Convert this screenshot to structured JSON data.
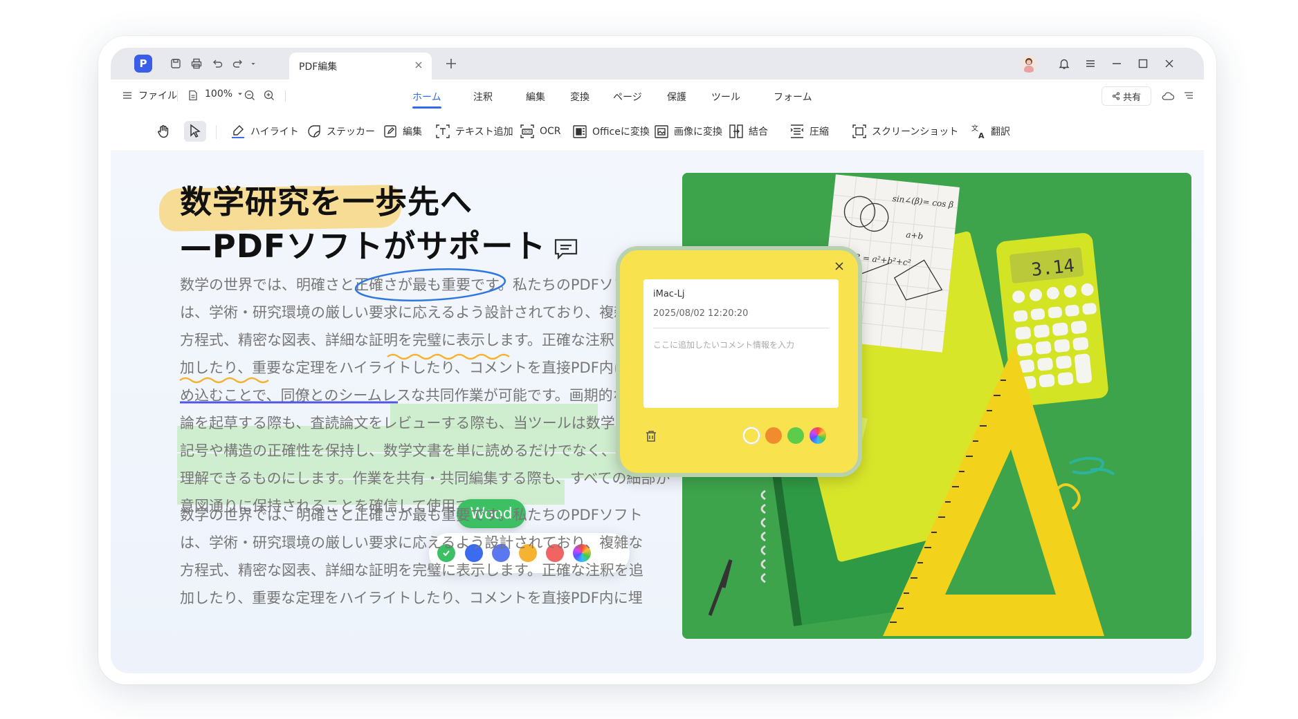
{
  "titlebar": {
    "tab_title": "PDF編集"
  },
  "menubar": {
    "file_label": "ファイル",
    "zoom_label": "100%",
    "items": [
      "ホーム",
      "注釈",
      "編集",
      "変換",
      "ページ",
      "保護",
      "ツール",
      "フォーム"
    ],
    "active_item": "ホーム",
    "share_label": "共有"
  },
  "toolbar": {
    "items": [
      {
        "label": "ハイライト",
        "icon": "highlighter-icon"
      },
      {
        "label": "ステッカー",
        "icon": "sticker-icon"
      },
      {
        "label": "編集",
        "icon": "edit-icon"
      },
      {
        "label": "テキスト追加",
        "icon": "add-text-icon"
      },
      {
        "label": "OCR",
        "icon": "ocr-icon"
      },
      {
        "label": "Officeに変換",
        "icon": "office-convert-icon"
      },
      {
        "label": "画像に変換",
        "icon": "image-convert-icon"
      },
      {
        "label": "結合",
        "icon": "merge-icon"
      },
      {
        "label": "圧縮",
        "icon": "compress-icon"
      },
      {
        "label": "スクリーンショット",
        "icon": "screenshot-icon"
      },
      {
        "label": "翻訳",
        "icon": "translate-icon"
      }
    ]
  },
  "document": {
    "heading_line1": "数学研究を一歩先へ",
    "heading_line2": "—PDFソフトがサポート",
    "para1": [
      "数学の世界では、明確さと正確さが最も重要です。私たちのPDFソフト",
      "は、学術・研究環境の厳しい要求に応えるよう設計されており、複雑な",
      "方程式、精密な図表、詳細な証明を完璧に表示します。正確な注釈を追",
      "加したり、重要な定理をハイライトしたり、コメントを直接PDF内に埋",
      "め込むことで、同僚とのシームレスな共同作業が可能です。画期的な論",
      "論を起草する際も、査読論文をレビューする際も、当ツールは数学的な",
      "記号や構造の正確性を保持し、数学文書を単に読めるだけでなく、深く",
      "理解できるものにします。作業を共有・共同編集する際も、すべての細部が",
      "意図通りに保持されることを確信して使用できます。"
    ],
    "para2": [
      "数学の世界では、明確さと正確さが最も重要です。私たちのPDFソフト",
      "は、学術・研究環境の厳しい要求に応えるよう設計されており、複雑な",
      "方程式、精密な図表、詳細な証明を完璧に表示します。正確な注釈を追",
      "加したり、重要な定理をハイライトしたり、コメントを直接PDF内に埋"
    ],
    "author_tag": "Wood",
    "palette_colors": [
      "#3cc063",
      "#3b6cf0",
      "#5b78f0",
      "#f5b331",
      "#f06464",
      "rainbow"
    ]
  },
  "comment_note": {
    "user": "iMac-Lj",
    "datetime": "2025/08/02 12:20:20",
    "placeholder": "ここに追加したいコメント情報を入力",
    "colors": [
      "#f8e24d",
      "#f08c2e",
      "#5ccc4a",
      "rainbow"
    ]
  },
  "photo": {
    "calculator_display": "3.14"
  }
}
